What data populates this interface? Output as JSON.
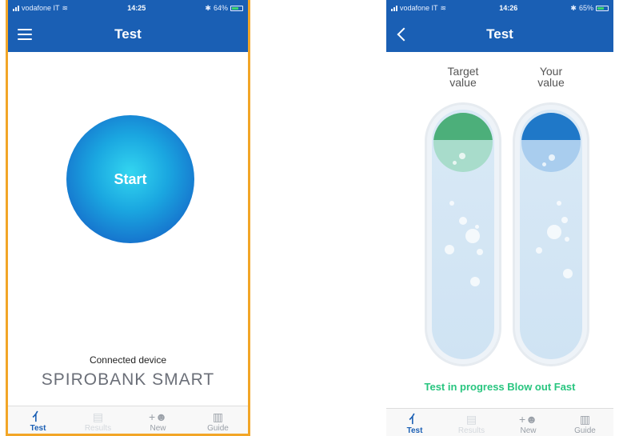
{
  "left_screen": {
    "status": {
      "carrier": "vodafone IT",
      "time": "14:25",
      "battery": "64%"
    },
    "title": "Test",
    "start_label": "Start",
    "connected_label": "Connected device",
    "device_name": "SPIROBANK SMART",
    "tabs": [
      {
        "label": "Test",
        "icon": "lungs-icon"
      },
      {
        "label": "Results",
        "icon": "list-icon"
      },
      {
        "label": "New",
        "icon": "add-user-icon"
      },
      {
        "label": "Guide",
        "icon": "document-icon"
      }
    ]
  },
  "right_screen": {
    "status": {
      "carrier": "vodafone IT",
      "time": "14:26",
      "battery": "65%"
    },
    "title": "Test",
    "target_header": [
      "Target",
      "value"
    ],
    "your_header": [
      "Your",
      "value"
    ],
    "progress_text": "Test in progress Blow out Fast",
    "tabs": [
      {
        "label": "Test",
        "icon": "lungs-icon"
      },
      {
        "label": "Results",
        "icon": "list-icon"
      },
      {
        "label": "New",
        "icon": "add-user-icon"
      },
      {
        "label": "Guide",
        "icon": "document-icon"
      }
    ]
  },
  "colors": {
    "nav_blue": "#1a5fb4",
    "frame_orange": "#f2a627",
    "target_green": "#4caf7a",
    "your_blue": "#1f78c8",
    "progress_green": "#28c57f"
  }
}
